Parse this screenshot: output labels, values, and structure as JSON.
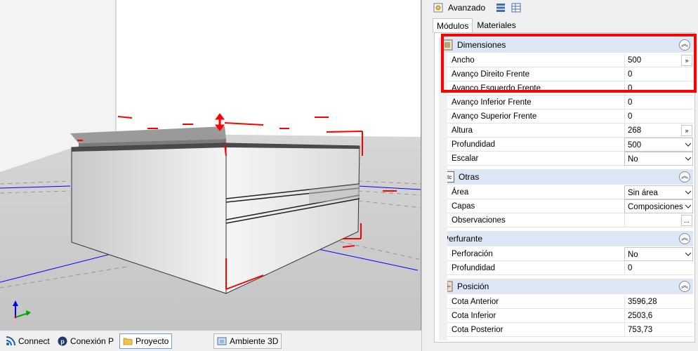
{
  "panel": {
    "title": "Avanzado",
    "tabs": [
      {
        "label": "Módulos",
        "active": true
      },
      {
        "label": "Materiales",
        "active": false
      }
    ],
    "sections": [
      {
        "title": "Dimensiones",
        "icon": "module-icon",
        "rows": [
          {
            "label": "Ancho",
            "value": "500",
            "control": "expand-button"
          },
          {
            "label": "Avanço Direito Frente",
            "value": "0"
          },
          {
            "label": "Avanço Esquerdo Frente",
            "value": "0"
          },
          {
            "label": "Avanço Inferior Frente",
            "value": "0"
          },
          {
            "label": "Avanço Superior Frente",
            "value": "0"
          },
          {
            "label": "Altura",
            "value": "268",
            "control": "expand-button"
          },
          {
            "label": "Profundidad",
            "value": "500",
            "control": "dropdown"
          },
          {
            "label": "Escalar",
            "value": "No",
            "control": "dropdown"
          }
        ]
      },
      {
        "title": "Otras",
        "icon": "etc-icon",
        "icon_text": "etc",
        "rows": [
          {
            "label": "Área",
            "value": "Sin área",
            "control": "dropdown"
          },
          {
            "label": "Capas",
            "value": "Composiciones",
            "control": "dropdown"
          },
          {
            "label": "Observaciones",
            "value": "",
            "control": "ellipsis-button"
          }
        ]
      },
      {
        "title": "Perfurante",
        "icon": "",
        "rows": [
          {
            "label": "Perforación",
            "value": "No",
            "control": "dropdown"
          },
          {
            "label": "Profundidad",
            "value": "0"
          }
        ]
      },
      {
        "title": "Posición",
        "icon": "position-icon",
        "rows": [
          {
            "label": "Cota Anterior",
            "value": "3596,28"
          },
          {
            "label": "Cota Inferior",
            "value": "2503,6"
          },
          {
            "label": "Cota Posterior",
            "value": "753,73"
          }
        ]
      }
    ],
    "expand_glyph": "»",
    "ellipsis_glyph": "...",
    "collapse_glyph": "︽"
  },
  "bottom_tabs": [
    {
      "label": "Connect",
      "icon": "rss-icon",
      "active": false
    },
    {
      "label": "Conexión P",
      "icon": "p-logo-icon",
      "active": false
    },
    {
      "label": "Proyecto",
      "icon": "folder-icon",
      "active": true
    },
    {
      "label": "Ambiente 3D",
      "icon": "3d-view-icon",
      "active": false
    }
  ],
  "colors": {
    "section_bg": "#dce6f4",
    "highlight": "#ff0000",
    "axis_x": "#0000ff",
    "axis_y": "#00aa00"
  }
}
